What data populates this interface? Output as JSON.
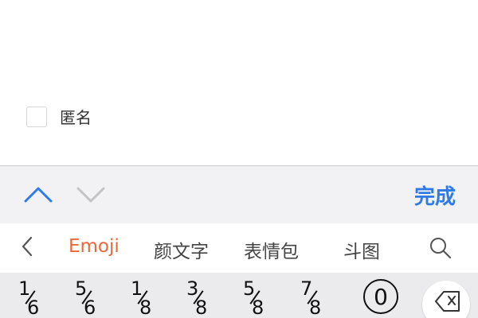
{
  "form": {
    "anonymous_label": "匿名",
    "anonymous_checked": false
  },
  "accessory_bar": {
    "prev_icon": "chevron-up-icon",
    "next_icon": "chevron-down-icon",
    "done_label": "完成",
    "accent_color": "#2f7ae5"
  },
  "emoji_tabs": {
    "back_icon": "chevron-left-icon",
    "items": [
      {
        "label": "Emoji",
        "active": true
      },
      {
        "label": "颜文字",
        "active": false
      },
      {
        "label": "表情包",
        "active": false
      },
      {
        "label": "斗图",
        "active": false
      }
    ],
    "search_icon": "search-icon",
    "active_color": "#e8683a"
  },
  "keys": [
    {
      "num": "1",
      "den": "6"
    },
    {
      "num": "5",
      "den": "6"
    },
    {
      "num": "1",
      "den": "8"
    },
    {
      "num": "3",
      "den": "8"
    },
    {
      "num": "5",
      "den": "8"
    },
    {
      "num": "7",
      "den": "8"
    }
  ],
  "circled_key": "0",
  "delete_icon": "backspace-icon"
}
